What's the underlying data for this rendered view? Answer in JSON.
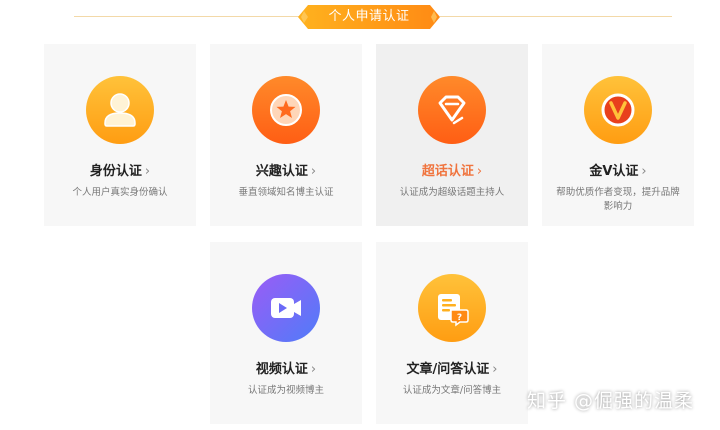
{
  "header": {
    "title": "个人申请认证"
  },
  "cards": [
    {
      "title": "身份认证",
      "desc": "个人用户真实身份确认",
      "icon": "user-icon"
    },
    {
      "title": "兴趣认证",
      "desc": "垂直领域知名博主认证",
      "icon": "star-icon"
    },
    {
      "title": "超话认证",
      "desc": "认证成为超级话题主持人",
      "icon": "diamond-icon"
    },
    {
      "title": "金V认证",
      "desc": "帮助优质作者变现，提升品牌影响力",
      "icon": "v-badge-icon"
    },
    {
      "title": "视频认证",
      "desc": "认证成为视频博主",
      "icon": "video-icon"
    },
    {
      "title": "文章/问答认证",
      "desc": "认证成为文章/问答博主",
      "icon": "article-qa-icon"
    }
  ],
  "chevron": "›",
  "watermark": "知乎 @倔强的温柔",
  "colors": {
    "accent_orange": "#ff8c1a",
    "hover_title": "#f0743e",
    "card_bg": "#f7f7f7",
    "video_gradient": [
      "#8b5cf6",
      "#5b6ef8"
    ]
  }
}
